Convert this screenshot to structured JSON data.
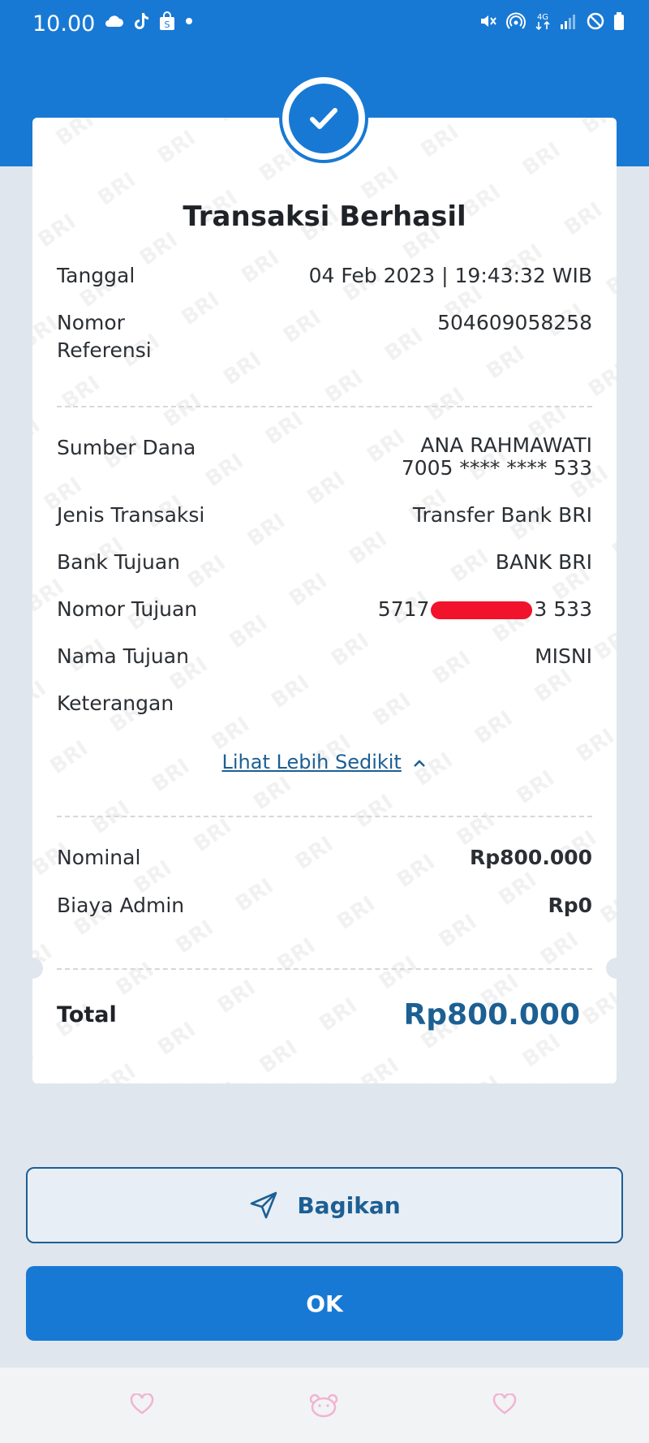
{
  "status_bar": {
    "time": "10.00",
    "network": "4G"
  },
  "receipt": {
    "title": "Transaksi Berhasil",
    "tanggal": {
      "label": "Tanggal",
      "value": "04 Feb 2023 | 19:43:32 WIB"
    },
    "nomor_referensi": {
      "label_line1": "Nomor",
      "label_line2": "Referensi",
      "value": "504609058258"
    },
    "sumber_dana": {
      "label": "Sumber Dana",
      "name": "ANA RAHMAWATI",
      "account": "7005 **** **** 533"
    },
    "jenis_transaksi": {
      "label": "Jenis Transaksi",
      "value": "Transfer Bank BRI"
    },
    "bank_tujuan": {
      "label": "Bank Tujuan",
      "value": "BANK BRI"
    },
    "nomor_tujuan": {
      "label": "Nomor Tujuan",
      "value_prefix": "5717",
      "value_suffix": "3 533"
    },
    "nama_tujuan": {
      "label": "Nama Tujuan",
      "value": "MISNI"
    },
    "keterangan": {
      "label": "Keterangan",
      "value": ""
    },
    "lihat_toggle": "Lihat Lebih Sedikit",
    "nominal": {
      "label": "Nominal",
      "value": "Rp800.000"
    },
    "biaya_admin": {
      "label": "Biaya Admin",
      "value": "Rp0"
    },
    "total": {
      "label": "Total",
      "value": "Rp800.000"
    }
  },
  "actions": {
    "share_label": "Bagikan",
    "ok_label": "OK"
  },
  "colors": {
    "primary": "#1879d4",
    "dark_blue": "#1c5f93",
    "background": "#dfe6ee"
  }
}
